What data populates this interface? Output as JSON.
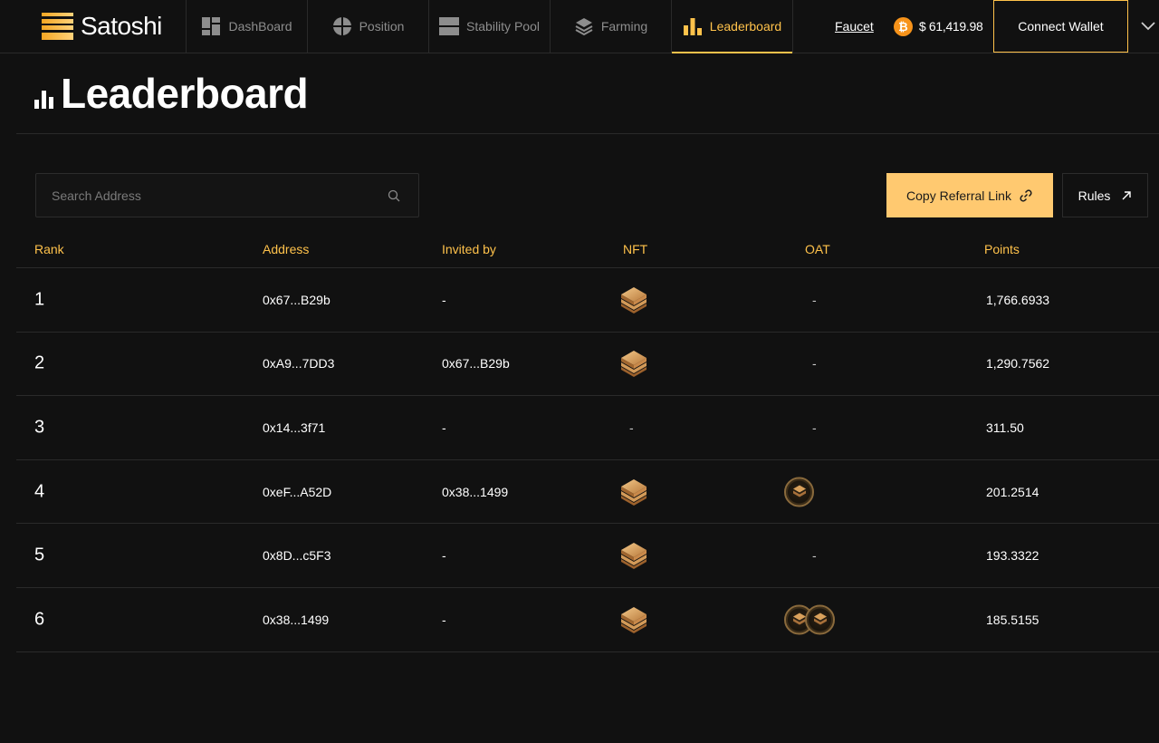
{
  "app": {
    "name": "Satoshi"
  },
  "nav": {
    "tabs": [
      {
        "label": "DashBoard",
        "icon": "dashboard-icon",
        "active": false
      },
      {
        "label": "Position",
        "icon": "position-icon",
        "active": false
      },
      {
        "label": "Stability Pool",
        "icon": "stability-pool-icon",
        "active": false
      },
      {
        "label": "Farming",
        "icon": "farming-icon",
        "active": false
      },
      {
        "label": "Leaderboard",
        "icon": "leaderboard-icon",
        "active": true
      }
    ],
    "faucet": "Faucet",
    "btc_symbol": "₿",
    "btc_price": "$ 61,419.98",
    "connect_wallet": "Connect Wallet"
  },
  "page": {
    "title": "Leaderboard"
  },
  "toolbar": {
    "search_placeholder": "Search Address",
    "referral_label": "Copy Referral Link",
    "rules_label": "Rules"
  },
  "table": {
    "headers": {
      "rank": "Rank",
      "address": "Address",
      "invited_by": "Invited by",
      "nft": "NFT",
      "oat": "OAT",
      "points": "Points"
    },
    "rows": [
      {
        "rank": "1",
        "address": "0x67...B29b",
        "invited_by": "-",
        "nft": true,
        "nft_text": "",
        "oat_count": 0,
        "oat_text": "-",
        "points": "1,766.6933"
      },
      {
        "rank": "2",
        "address": "0xA9...7DD3",
        "invited_by": "0x67...B29b",
        "nft": true,
        "nft_text": "",
        "oat_count": 0,
        "oat_text": "-",
        "points": "1,290.7562"
      },
      {
        "rank": "3",
        "address": "0x14...3f71",
        "invited_by": "-",
        "nft": false,
        "nft_text": "-",
        "oat_count": 0,
        "oat_text": "-",
        "points": "311.50"
      },
      {
        "rank": "4",
        "address": "0xeF...A52D",
        "invited_by": "0x38...1499",
        "nft": true,
        "nft_text": "",
        "oat_count": 1,
        "oat_text": "",
        "points": "201.2514"
      },
      {
        "rank": "5",
        "address": "0x8D...c5F3",
        "invited_by": "-",
        "nft": true,
        "nft_text": "",
        "oat_count": 0,
        "oat_text": "-",
        "points": "193.3322"
      },
      {
        "rank": "6",
        "address": "0x38...1499",
        "invited_by": "-",
        "nft": true,
        "nft_text": "",
        "oat_count": 2,
        "oat_text": "",
        "points": "185.5155"
      }
    ]
  },
  "colors": {
    "accent": "#ffc24b",
    "referral_button": "#ffc970",
    "background": "#111111",
    "btc": "#f7931a"
  }
}
